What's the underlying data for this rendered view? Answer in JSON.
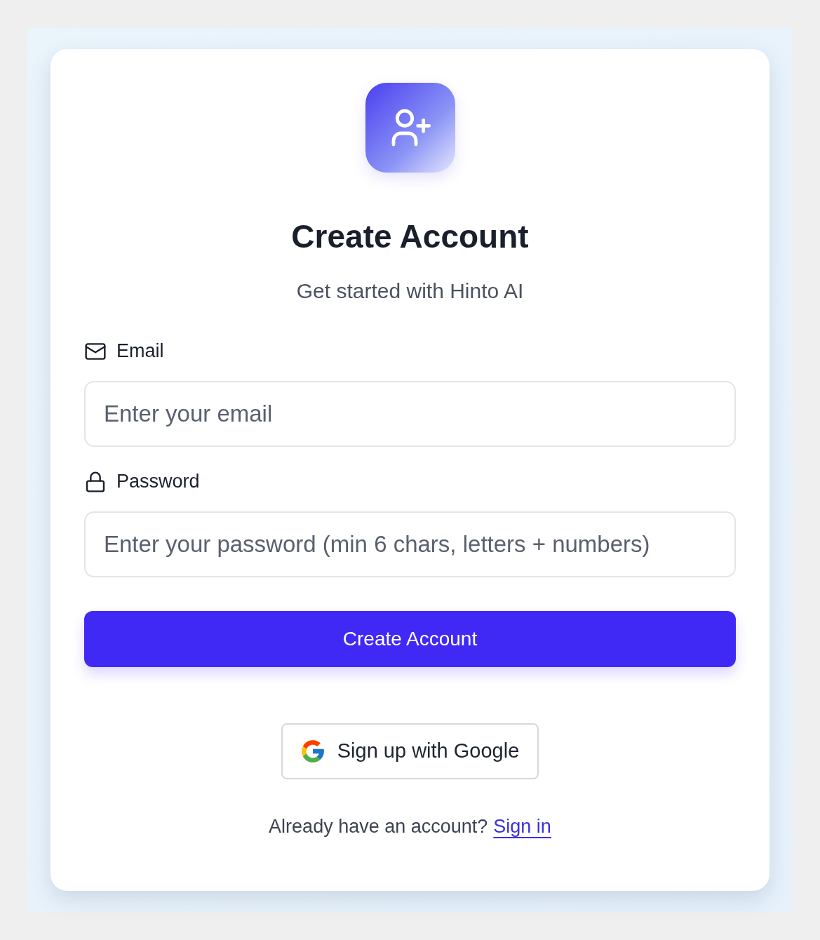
{
  "title": "Create Account",
  "subtitle": "Get started with Hinto AI",
  "fields": [
    {
      "kind": "email",
      "label": "Email",
      "placeholder": "Enter your email"
    },
    {
      "kind": "password",
      "label": "Password",
      "placeholder": "Enter your password (min 6 chars, letters + numbers)"
    }
  ],
  "submit_button": "Create Account",
  "google_button": "Sign up with Google",
  "footer": {
    "text": "Already have an account?",
    "link": "Sign in"
  }
}
